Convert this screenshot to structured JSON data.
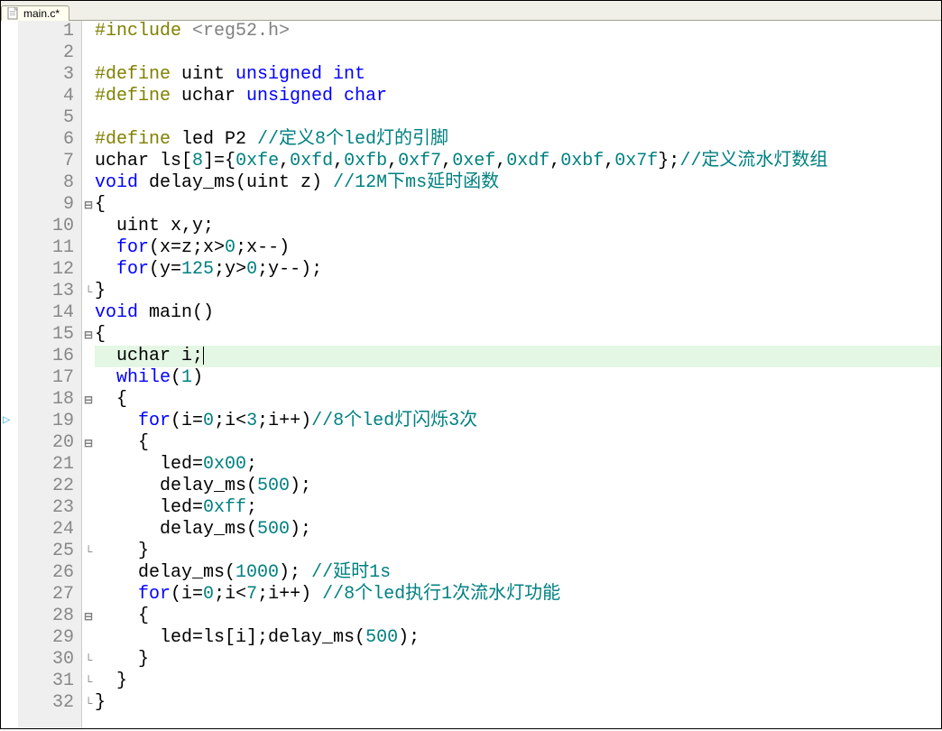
{
  "tab": {
    "filename": "main.c*"
  },
  "lineCount": 32,
  "highlightLine": 16,
  "bookmarkLine": 19,
  "foldMarks": {
    "9": "⊟",
    "13": "└",
    "15": "⊟",
    "18": "⊟",
    "20": "⊟",
    "25": "└",
    "28": "⊟",
    "30": "└",
    "31": "└",
    "32": "└"
  },
  "code": {
    "l1": [
      {
        "t": "#include ",
        "c": "pre"
      },
      {
        "t": "<reg52.h>",
        "c": "inc"
      }
    ],
    "l2": [
      {
        "t": "",
        "c": "txt"
      }
    ],
    "l3": [
      {
        "t": "#define ",
        "c": "pre"
      },
      {
        "t": "uint ",
        "c": "txt"
      },
      {
        "t": "unsigned int",
        "c": "key"
      }
    ],
    "l4": [
      {
        "t": "#define ",
        "c": "pre"
      },
      {
        "t": "uchar ",
        "c": "txt"
      },
      {
        "t": "unsigned char",
        "c": "key"
      }
    ],
    "l5": [
      {
        "t": "",
        "c": "txt"
      }
    ],
    "l6": [
      {
        "t": "#define ",
        "c": "pre"
      },
      {
        "t": "led P2 ",
        "c": "txt"
      },
      {
        "t": "//定义8个led灯的引脚",
        "c": "com"
      }
    ],
    "l7": [
      {
        "t": "uchar ls[",
        "c": "txt"
      },
      {
        "t": "8",
        "c": "num"
      },
      {
        "t": "]={",
        "c": "txt"
      },
      {
        "t": "0xfe",
        "c": "num"
      },
      {
        "t": ",",
        "c": "txt"
      },
      {
        "t": "0xfd",
        "c": "num"
      },
      {
        "t": ",",
        "c": "txt"
      },
      {
        "t": "0xfb",
        "c": "num"
      },
      {
        "t": ",",
        "c": "txt"
      },
      {
        "t": "0xf7",
        "c": "num"
      },
      {
        "t": ",",
        "c": "txt"
      },
      {
        "t": "0xef",
        "c": "num"
      },
      {
        "t": ",",
        "c": "txt"
      },
      {
        "t": "0xdf",
        "c": "num"
      },
      {
        "t": ",",
        "c": "txt"
      },
      {
        "t": "0xbf",
        "c": "num"
      },
      {
        "t": ",",
        "c": "txt"
      },
      {
        "t": "0x7f",
        "c": "num"
      },
      {
        "t": "};",
        "c": "txt"
      },
      {
        "t": "//定义流水灯数组",
        "c": "com"
      }
    ],
    "l8": [
      {
        "t": "void",
        "c": "key"
      },
      {
        "t": " delay_ms(uint z) ",
        "c": "txt"
      },
      {
        "t": "//12M下ms延时函数",
        "c": "com"
      }
    ],
    "l9": [
      {
        "t": "{",
        "c": "txt"
      }
    ],
    "l10": [
      {
        "t": "  uint x,y;",
        "c": "txt"
      }
    ],
    "l11": [
      {
        "t": "  ",
        "c": "txt"
      },
      {
        "t": "for",
        "c": "key"
      },
      {
        "t": "(x=z;x>",
        "c": "txt"
      },
      {
        "t": "0",
        "c": "num"
      },
      {
        "t": ";x--)",
        "c": "txt"
      }
    ],
    "l12": [
      {
        "t": "  ",
        "c": "txt"
      },
      {
        "t": "for",
        "c": "key"
      },
      {
        "t": "(y=",
        "c": "txt"
      },
      {
        "t": "125",
        "c": "num"
      },
      {
        "t": ";y>",
        "c": "txt"
      },
      {
        "t": "0",
        "c": "num"
      },
      {
        "t": ";y--);",
        "c": "txt"
      }
    ],
    "l13": [
      {
        "t": "}",
        "c": "txt"
      }
    ],
    "l14": [
      {
        "t": "void",
        "c": "key"
      },
      {
        "t": " main()",
        "c": "txt"
      }
    ],
    "l15": [
      {
        "t": "{",
        "c": "txt"
      }
    ],
    "l16": [
      {
        "t": "  uchar i;",
        "c": "txt"
      }
    ],
    "l17": [
      {
        "t": "  ",
        "c": "txt"
      },
      {
        "t": "while",
        "c": "key"
      },
      {
        "t": "(",
        "c": "txt"
      },
      {
        "t": "1",
        "c": "num"
      },
      {
        "t": ")",
        "c": "txt"
      }
    ],
    "l18": [
      {
        "t": "  {",
        "c": "txt"
      }
    ],
    "l19": [
      {
        "t": "    ",
        "c": "txt"
      },
      {
        "t": "for",
        "c": "key"
      },
      {
        "t": "(i=",
        "c": "txt"
      },
      {
        "t": "0",
        "c": "num"
      },
      {
        "t": ";i<",
        "c": "txt"
      },
      {
        "t": "3",
        "c": "num"
      },
      {
        "t": ";i++)",
        "c": "txt"
      },
      {
        "t": "//8个led灯闪烁3次",
        "c": "com"
      }
    ],
    "l20": [
      {
        "t": "    {",
        "c": "txt"
      }
    ],
    "l21": [
      {
        "t": "      led=",
        "c": "txt"
      },
      {
        "t": "0x00",
        "c": "num"
      },
      {
        "t": ";",
        "c": "txt"
      }
    ],
    "l22": [
      {
        "t": "      delay_ms(",
        "c": "txt"
      },
      {
        "t": "500",
        "c": "num"
      },
      {
        "t": ");",
        "c": "txt"
      }
    ],
    "l23": [
      {
        "t": "      led=",
        "c": "txt"
      },
      {
        "t": "0xff",
        "c": "num"
      },
      {
        "t": ";",
        "c": "txt"
      }
    ],
    "l24": [
      {
        "t": "      delay_ms(",
        "c": "txt"
      },
      {
        "t": "500",
        "c": "num"
      },
      {
        "t": ");",
        "c": "txt"
      }
    ],
    "l25": [
      {
        "t": "    }",
        "c": "txt"
      }
    ],
    "l26": [
      {
        "t": "    delay_ms(",
        "c": "txt"
      },
      {
        "t": "1000",
        "c": "num"
      },
      {
        "t": "); ",
        "c": "txt"
      },
      {
        "t": "//延时1s",
        "c": "com"
      }
    ],
    "l27": [
      {
        "t": "    ",
        "c": "txt"
      },
      {
        "t": "for",
        "c": "key"
      },
      {
        "t": "(i=",
        "c": "txt"
      },
      {
        "t": "0",
        "c": "num"
      },
      {
        "t": ";i<",
        "c": "txt"
      },
      {
        "t": "7",
        "c": "num"
      },
      {
        "t": ";i++) ",
        "c": "txt"
      },
      {
        "t": "//8个led执行1次流水灯功能",
        "c": "com"
      }
    ],
    "l28": [
      {
        "t": "    {",
        "c": "txt"
      }
    ],
    "l29": [
      {
        "t": "      led=ls[i];delay_ms(",
        "c": "txt"
      },
      {
        "t": "500",
        "c": "num"
      },
      {
        "t": ");",
        "c": "txt"
      }
    ],
    "l30": [
      {
        "t": "    }",
        "c": "txt"
      }
    ],
    "l31": [
      {
        "t": "  }",
        "c": "txt"
      }
    ],
    "l32": [
      {
        "t": "}",
        "c": "txt"
      }
    ]
  }
}
